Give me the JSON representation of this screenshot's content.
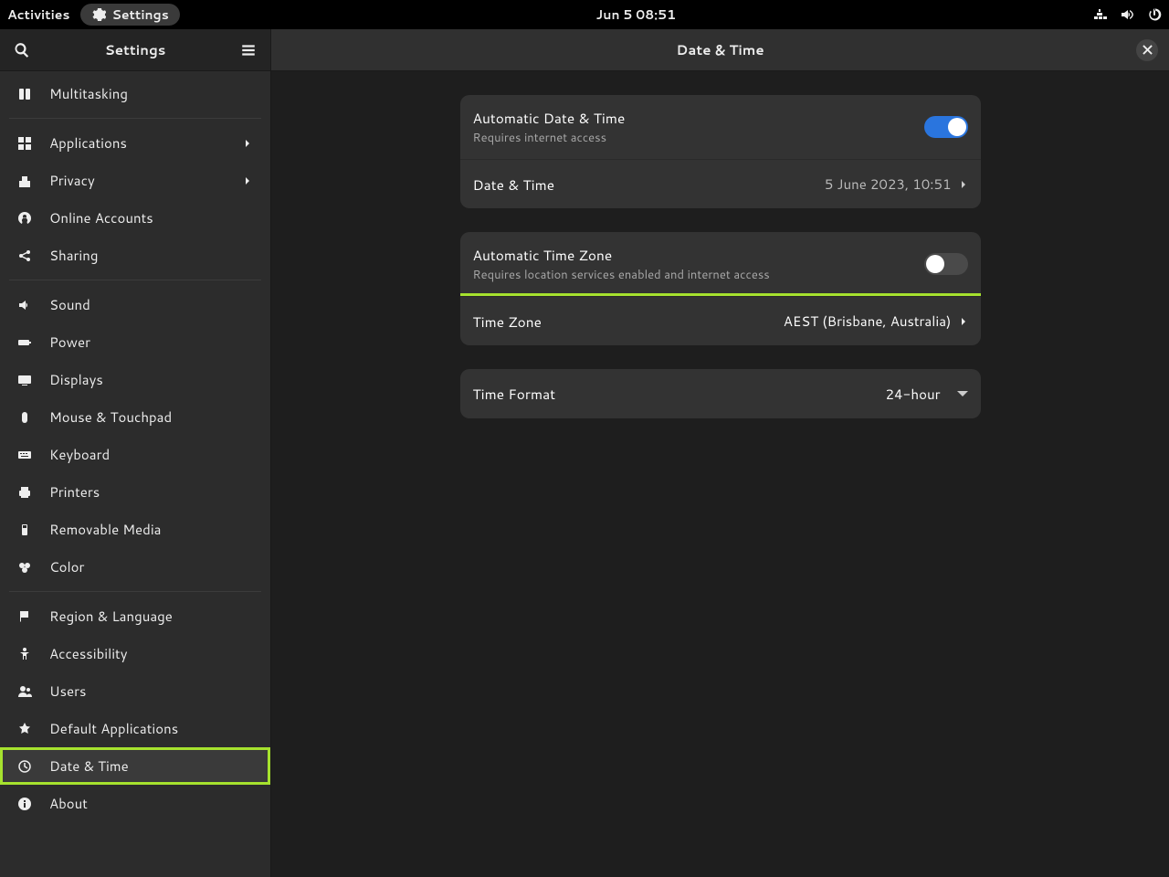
{
  "top_panel": {
    "activities": "Activities",
    "app_label": "Settings",
    "clock": "Jun 5  08:51"
  },
  "sidebar": {
    "title": "Settings",
    "items": [
      {
        "label": "Multitasking",
        "icon": "multitasking"
      },
      {
        "sep": true
      },
      {
        "label": "Applications",
        "icon": "applications",
        "chevron": true
      },
      {
        "label": "Privacy",
        "icon": "privacy",
        "chevron": true
      },
      {
        "label": "Online Accounts",
        "icon": "online-accounts"
      },
      {
        "label": "Sharing",
        "icon": "sharing"
      },
      {
        "sep": true
      },
      {
        "label": "Sound",
        "icon": "sound"
      },
      {
        "label": "Power",
        "icon": "power"
      },
      {
        "label": "Displays",
        "icon": "displays"
      },
      {
        "label": "Mouse & Touchpad",
        "icon": "mouse"
      },
      {
        "label": "Keyboard",
        "icon": "keyboard"
      },
      {
        "label": "Printers",
        "icon": "printers"
      },
      {
        "label": "Removable Media",
        "icon": "removable"
      },
      {
        "label": "Color",
        "icon": "color"
      },
      {
        "sep": true
      },
      {
        "label": "Region & Language",
        "icon": "region"
      },
      {
        "label": "Accessibility",
        "icon": "accessibility"
      },
      {
        "label": "Users",
        "icon": "users"
      },
      {
        "label": "Default Applications",
        "icon": "default-apps"
      },
      {
        "label": "Date & Time",
        "icon": "date-time",
        "selected": true,
        "highlight": true
      },
      {
        "label": "About",
        "icon": "about"
      }
    ]
  },
  "content": {
    "title": "Date & Time",
    "auto_dt": {
      "title": "Automatic Date & Time",
      "subtitle": "Requires internet access",
      "on": true
    },
    "dt_row": {
      "title": "Date & Time",
      "value": "5 June 2023, 10:51"
    },
    "auto_tz": {
      "title": "Automatic Time Zone",
      "subtitle": "Requires location services enabled and internet access",
      "on": false
    },
    "tz_row": {
      "title": "Time Zone",
      "value": "AEST (Brisbane, Australia)",
      "highlight": true
    },
    "fmt_row": {
      "title": "Time Format",
      "value": "24-hour"
    }
  },
  "highlight_color": "#a6e22e"
}
